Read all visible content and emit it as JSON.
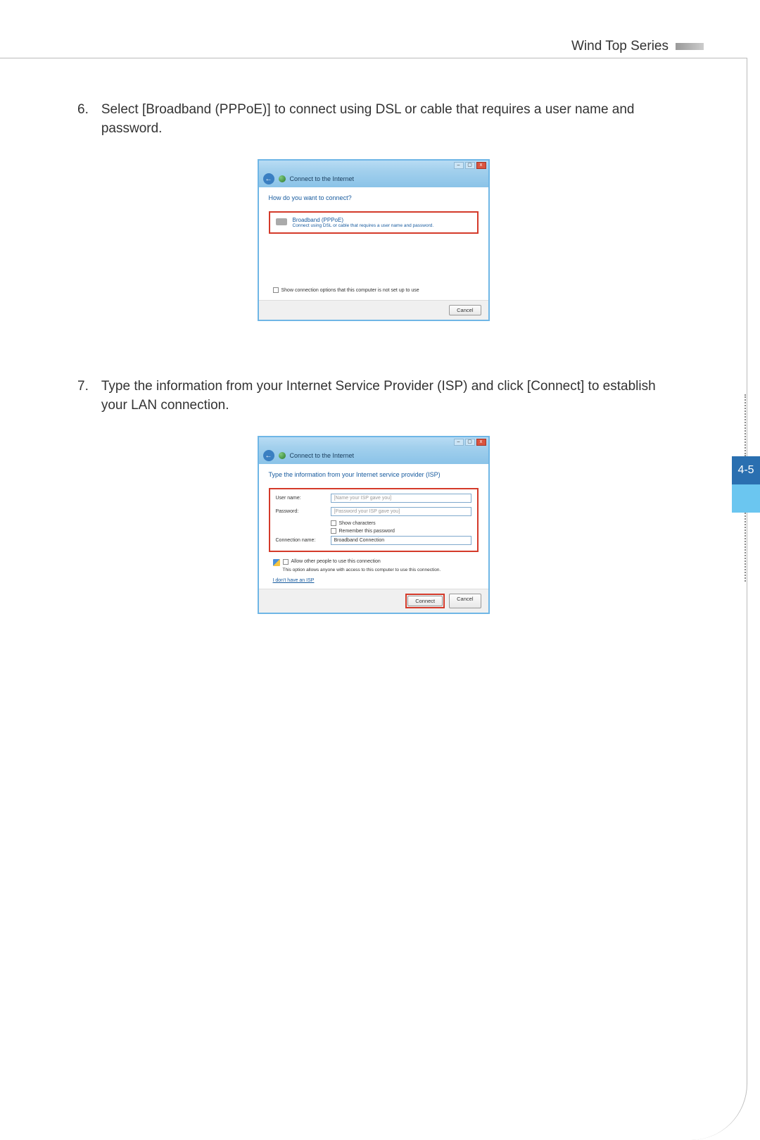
{
  "header": {
    "series_title": "Wind Top Series"
  },
  "page_number": "4-5",
  "steps": [
    {
      "num": "6.",
      "text": "Select [Broadband (PPPoE)] to connect using DSL or cable that requires a user name and password."
    },
    {
      "num": "7.",
      "text": "Type the information from your Internet Service Provider (ISP) and click [Connect] to establish your LAN connection."
    }
  ],
  "dialog1": {
    "nav_title": "Connect to the Internet",
    "heading": "How do you want to connect?",
    "option_title": "Broadband (PPPoE)",
    "option_sub": "Connect using DSL or cable that requires a user name and password.",
    "show_options": "Show connection options that this computer is not set up to use",
    "cancel": "Cancel"
  },
  "dialog2": {
    "nav_title": "Connect to the Internet",
    "heading": "Type the information from your Internet service provider (ISP)",
    "username_label": "User name:",
    "username_placeholder": "[Name your ISP gave you]",
    "password_label": "Password:",
    "password_placeholder": "[Password your ISP gave you]",
    "show_chars": "Show characters",
    "remember": "Remember this password",
    "conn_name_label": "Connection name:",
    "conn_name_value": "Broadband Connection",
    "allow_others": "Allow other people to use this connection",
    "allow_sub": "This option allows anyone with access to this computer to use this connection.",
    "no_isp": "I don't have an ISP",
    "connect": "Connect",
    "cancel": "Cancel"
  }
}
